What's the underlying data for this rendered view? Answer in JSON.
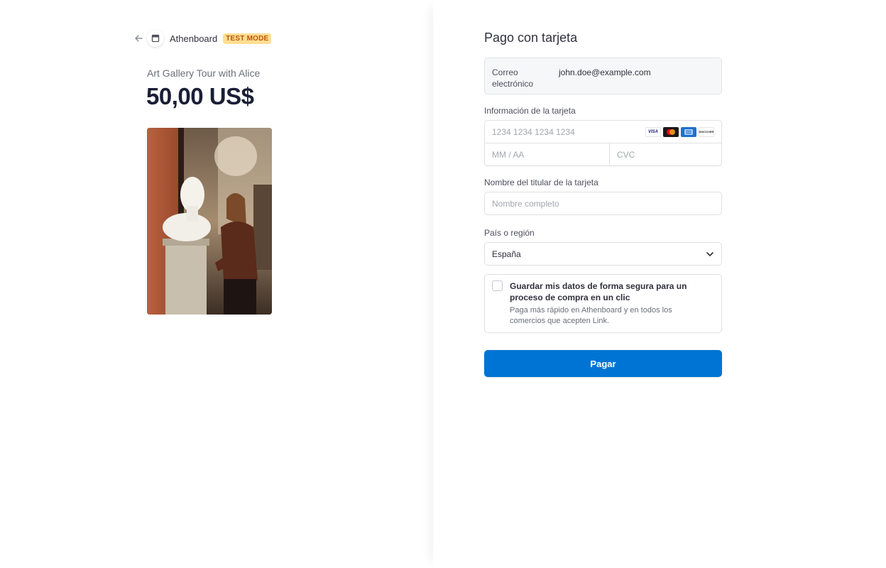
{
  "header": {
    "merchant_name": "Athenboard",
    "test_badge": "TEST MODE"
  },
  "product": {
    "name": "Art Gallery Tour with Alice",
    "price": "50,00 US$"
  },
  "form": {
    "title": "Pago con tarjeta",
    "email": {
      "label": "Correo electrónico",
      "value": "john.doe@example.com"
    },
    "card": {
      "label": "Información de la tarjeta",
      "number_placeholder": "1234 1234 1234 1234",
      "expiry_placeholder": "MM / AA",
      "cvc_placeholder": "CVC",
      "brands": [
        "VISA",
        "Mastercard",
        "American Express",
        "DISCOVER"
      ]
    },
    "cardholder": {
      "label": "Nombre del titular de la tarjeta",
      "placeholder": "Nombre completo"
    },
    "country": {
      "label": "País o región",
      "selected": "España"
    },
    "save": {
      "title": "Guardar mis datos de forma segura para un proceso de compra en un clic",
      "description": "Paga más rápido en Athenboard y en todos los comercios que acepten Link."
    },
    "pay_button": "Pagar"
  },
  "colors": {
    "pay_button": "#0074d4",
    "badge_bg": "#ffde92",
    "badge_text": "#bb5504"
  }
}
